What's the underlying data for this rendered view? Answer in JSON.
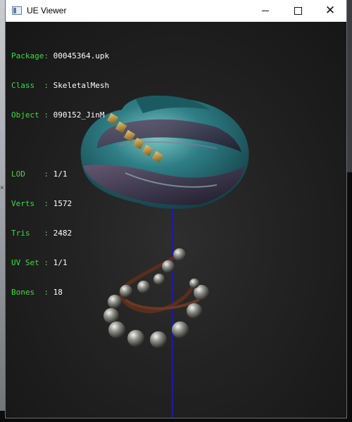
{
  "window": {
    "title": "UE Viewer"
  },
  "info": {
    "package": {
      "label": "Package: ",
      "value": "00045364.upk"
    },
    "class": {
      "label": "Class  : ",
      "value": "SkeletalMesh"
    },
    "object": {
      "label": "Object : ",
      "value": "090152_JinM"
    },
    "lod": {
      "label": "LOD    : ",
      "value": "1/1"
    },
    "verts": {
      "label": "Verts  : ",
      "value": "1572"
    },
    "tris": {
      "label": "Tris   : ",
      "value": "2482"
    },
    "uvset": {
      "label": "UV Set : ",
      "value": "1/1"
    },
    "bones": {
      "label": "Bones  : ",
      "value": "18"
    }
  },
  "colors": {
    "label_green": "#3ddc3d",
    "axis_blue": "#1a1aa8",
    "turban_teal": "#2f7f86",
    "turban_purple": "#3b2f44"
  },
  "icons": {
    "minimize": "minimize-icon",
    "maximize": "maximize-icon",
    "close": "close-icon"
  }
}
